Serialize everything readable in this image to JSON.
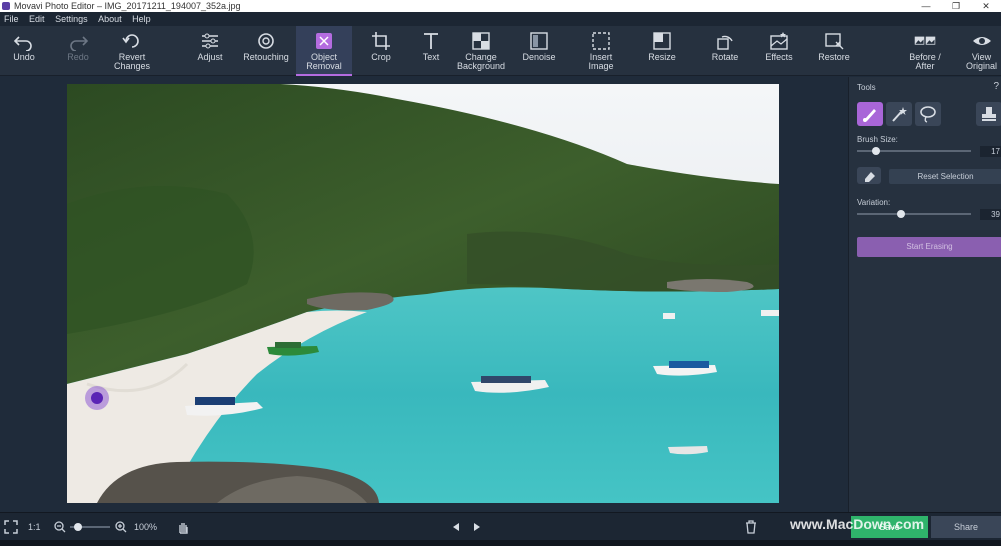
{
  "window": {
    "title": "Movavi Photo Editor – IMG_20171211_194007_352a.jpg",
    "minimize": "—",
    "maximize": "❐",
    "close": "✕"
  },
  "menu": [
    "File",
    "Edit",
    "Settings",
    "About",
    "Help"
  ],
  "toolbar": {
    "tools": [
      {
        "label": "Undo",
        "icon": "undo-icon"
      },
      {
        "label": "Redo",
        "icon": "redo-icon"
      },
      {
        "label": "Revert\nChanges",
        "icon": "revert-icon"
      },
      {
        "label": "Adjust",
        "icon": "sliders-icon"
      },
      {
        "label": "Retouching",
        "icon": "retouch-icon"
      },
      {
        "label": "Object\nRemoval",
        "icon": "object-removal-icon"
      },
      {
        "label": "Crop",
        "icon": "crop-icon"
      },
      {
        "label": "Text",
        "icon": "text-icon"
      },
      {
        "label": "Change\nBackground",
        "icon": "background-icon"
      },
      {
        "label": "Denoise",
        "icon": "denoise-icon"
      },
      {
        "label": "Insert\nImage",
        "icon": "insert-image-icon"
      },
      {
        "label": "Resize",
        "icon": "resize-icon"
      },
      {
        "label": "Rotate",
        "icon": "rotate-icon"
      },
      {
        "label": "Effects",
        "icon": "effects-icon"
      },
      {
        "label": "Restore",
        "icon": "restore-icon"
      },
      {
        "label": "Before /\nAfter",
        "icon": "before-after-icon"
      },
      {
        "label": "View\nOriginal",
        "icon": "eye-icon"
      }
    ]
  },
  "panel": {
    "title": "Tools",
    "help": "?",
    "brush_size_label": "Brush Size:",
    "brush_size_value": "17",
    "brush_size_level": 0.17,
    "reset_selection": "Reset Selection",
    "variation_label": "Variation:",
    "variation_value": "39",
    "variation_level": 0.39,
    "start_erasing": "Start Erasing"
  },
  "bottom": {
    "ratio": "1:1",
    "zoom_percent": "100%",
    "zoom_level": 0.2,
    "save": "Save",
    "share": "Share"
  },
  "watermark": "www.MacDown.com",
  "colors": {
    "accent": "#a966d8",
    "save_green": "#2fb36b"
  }
}
